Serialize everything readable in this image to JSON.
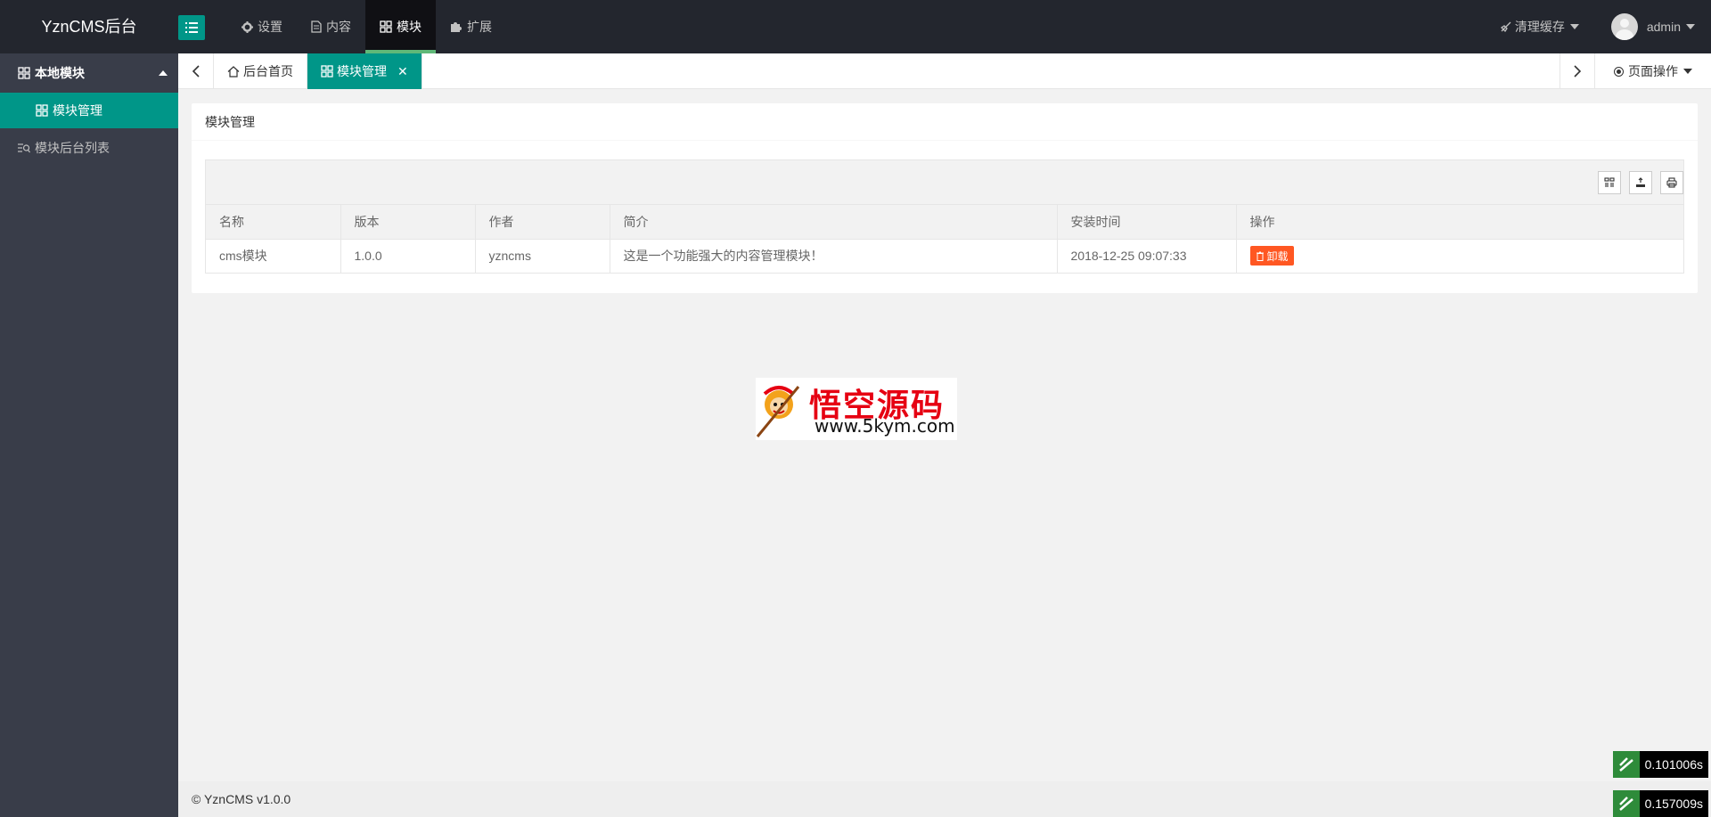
{
  "app": {
    "logo": "YznCMS后台"
  },
  "header": {
    "nav": [
      {
        "label": "设置",
        "icon": "gear-icon"
      },
      {
        "label": "内容",
        "icon": "document-icon"
      },
      {
        "label": "模块",
        "icon": "modules-icon",
        "active": true
      },
      {
        "label": "扩展",
        "icon": "puzzle-icon"
      }
    ],
    "clear_cache": "清理缓存",
    "user": "admin"
  },
  "sidebar": {
    "group": "本地模块",
    "active_item": "模块管理",
    "item": "模块后台列表"
  },
  "tabs": {
    "home": "后台首页",
    "current": "模块管理",
    "close": "✕",
    "page_ops": "页面操作"
  },
  "card": {
    "title": "模块管理",
    "columns": [
      "名称",
      "版本",
      "作者",
      "简介",
      "安装时间",
      "操作"
    ],
    "rows": [
      {
        "name": "cms模块",
        "version": "1.0.0",
        "author": "yzncms",
        "desc": "这是一个功能强大的内容管理模块！",
        "installed": "2018-12-25 09:07:33",
        "action": "卸载"
      }
    ]
  },
  "watermark": {
    "title": "悟空源码",
    "url": "www.5kym.com"
  },
  "footer": {
    "copyright": "© YznCMS v1.0.0"
  },
  "debug": {
    "time1": "0.101006s",
    "time2": "0.157009s"
  },
  "colors": {
    "accent": "#009688",
    "header_bg": "#23262e",
    "sidebar_bg": "#393d49",
    "danger": "#ff5722"
  }
}
